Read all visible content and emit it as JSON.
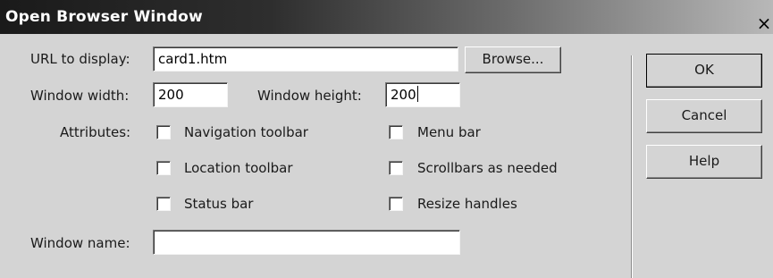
{
  "window": {
    "title": "Open Browser Window",
    "close_glyph": "×",
    "background_color": "#d4d4d4"
  },
  "form": {
    "url_label": "URL to display:",
    "url_value": "card1.htm",
    "browse_label": "Browse...",
    "width_label": "Window width:",
    "width_value": "200",
    "height_label": "Window height:",
    "height_value": "200",
    "attributes_label": "Attributes:",
    "attributes": [
      {
        "label": "Navigation toolbar",
        "checked": false
      },
      {
        "label": "Menu bar",
        "checked": false
      },
      {
        "label": "Location toolbar",
        "checked": false
      },
      {
        "label": "Scrollbars as needed",
        "checked": false
      },
      {
        "label": "Status bar",
        "checked": false
      },
      {
        "label": "Resize handles",
        "checked": false
      }
    ],
    "name_label": "Window name:",
    "name_value": ""
  },
  "actions": {
    "ok_label": "OK",
    "cancel_label": "Cancel",
    "help_label": "Help"
  },
  "icons": {
    "close": "close-icon",
    "checkbox": "checkbox-unchecked-icon"
  }
}
